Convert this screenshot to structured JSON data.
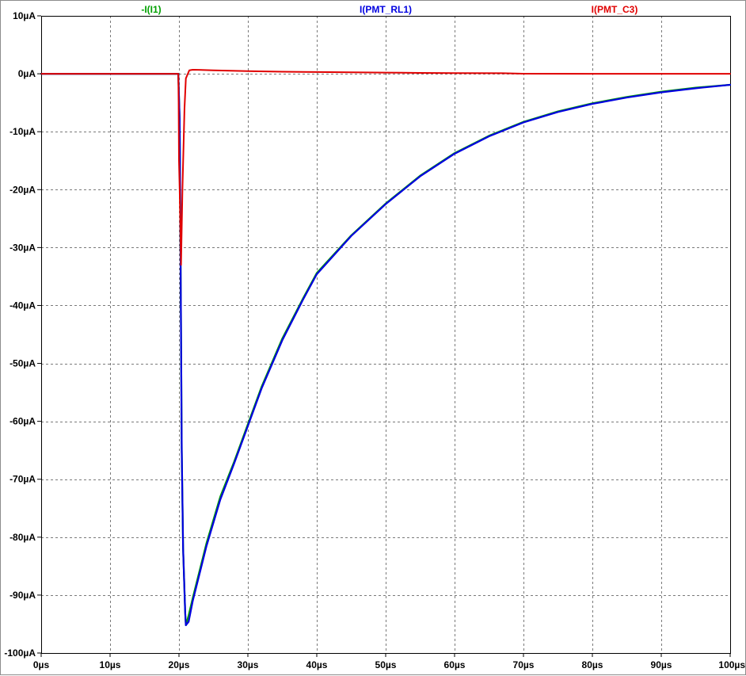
{
  "chart_data": {
    "type": "line",
    "title": "",
    "xlabel": "",
    "ylabel": "",
    "xlim": [
      0,
      100
    ],
    "ylim": [
      -100,
      10
    ],
    "x_unit": "µs",
    "y_unit": "µA",
    "grid": true,
    "x_ticks": [
      0,
      10,
      20,
      30,
      40,
      50,
      60,
      70,
      80,
      90,
      100
    ],
    "y_ticks": [
      10,
      0,
      -10,
      -20,
      -30,
      -40,
      -50,
      -60,
      -70,
      -80,
      -90,
      -100
    ],
    "x_tick_labels": [
      "0µs",
      "10µs",
      "20µs",
      "30µs",
      "40µs",
      "50µs",
      "60µs",
      "70µs",
      "80µs",
      "90µs",
      "100µs"
    ],
    "y_tick_labels": [
      "10µA",
      "0µA",
      "-10µA",
      "-20µA",
      "-30µA",
      "-40µA",
      "-50µA",
      "-60µA",
      "-70µA",
      "-80µA",
      "-90µA",
      "-100µA"
    ],
    "series": [
      {
        "name": "-I(I1)",
        "color": "#00a000",
        "x": [
          0,
          19.9,
          20.1,
          20.2,
          20.3,
          20.4,
          20.6,
          20.9,
          21,
          21.4,
          22,
          24,
          26,
          28,
          30,
          32,
          35,
          38,
          40,
          45,
          50,
          55,
          60,
          65,
          70,
          75,
          80,
          85,
          90,
          95,
          100
        ],
        "y": [
          0,
          0,
          -8,
          -25,
          -45,
          -65,
          -82,
          -93,
          -95.2,
          -93.5,
          -90.5,
          -81,
          -73,
          -67,
          -60.5,
          -54,
          -45.7,
          -38.8,
          -34.4,
          -27.9,
          -22.4,
          -17.6,
          -13.7,
          -10.7,
          -8.3,
          -6.5,
          -5.1,
          -4,
          -3.1,
          -2.4,
          -1.9
        ]
      },
      {
        "name": "I(PMT_RL1)",
        "color": "#0000e0",
        "x": [
          0,
          19.9,
          20.1,
          20.2,
          20.3,
          20.4,
          20.6,
          20.9,
          21,
          21.4,
          22,
          24,
          26,
          28,
          30,
          32,
          35,
          38,
          40,
          45,
          50,
          55,
          60,
          65,
          70,
          75,
          80,
          85,
          90,
          95,
          100
        ],
        "y": [
          0,
          0,
          -8,
          -25,
          -45,
          -65,
          -82,
          -93,
          -95.2,
          -94.6,
          -91,
          -81.5,
          -73.5,
          -67.3,
          -60.8,
          -54.3,
          -46,
          -39,
          -34.6,
          -28,
          -22.5,
          -17.7,
          -13.8,
          -10.8,
          -8.4,
          -6.6,
          -5.2,
          -4.1,
          -3.2,
          -2.5,
          -1.9
        ]
      },
      {
        "name": "I(PMT_C3)",
        "color": "#e00000",
        "x": [
          0,
          19.9,
          19.95,
          20.0,
          20.1,
          20.3,
          20.5,
          20.8,
          21,
          21.5,
          22,
          25,
          30,
          35,
          40,
          45,
          50,
          55,
          60,
          67,
          70,
          80,
          90,
          100
        ],
        "y": [
          0,
          0,
          -5,
          -15,
          -20,
          -33,
          -20,
          -6,
          -0.8,
          0.6,
          0.7,
          0.6,
          0.45,
          0.35,
          0.3,
          0.25,
          0.2,
          0.15,
          0.12,
          0.1,
          0.02,
          0,
          0,
          0
        ]
      }
    ]
  }
}
